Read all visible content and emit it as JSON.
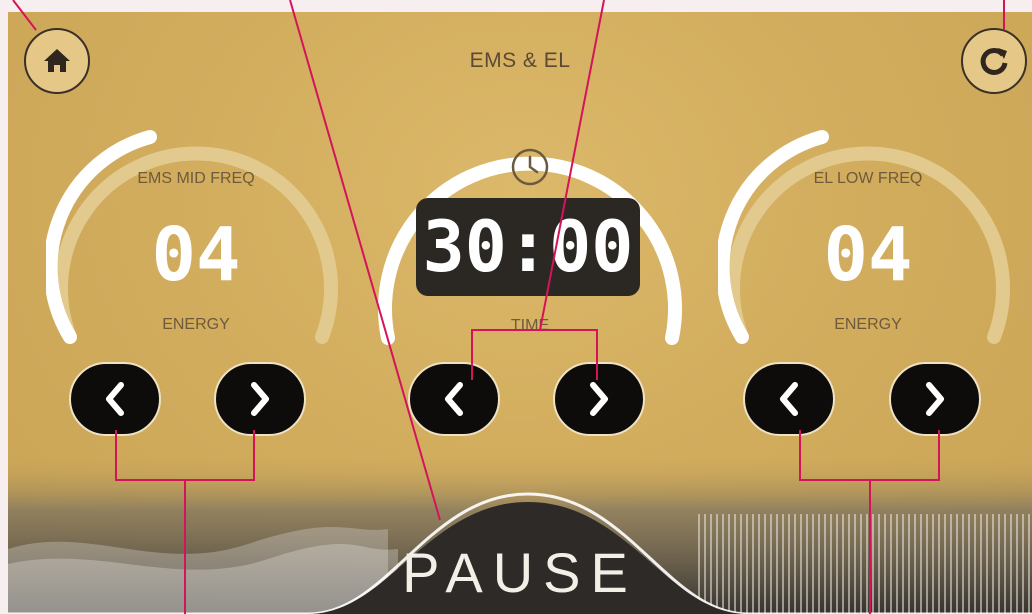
{
  "header": {
    "title": "EMS & EL"
  },
  "icons": {
    "home": "home-icon",
    "refresh": "refresh-icon",
    "clock": "clock-icon"
  },
  "dials": [
    {
      "label": "EMS MID FREQ",
      "value": "04",
      "sublabel": "ENERGY"
    },
    {
      "label": "",
      "value": "30:00",
      "sublabel": "TIME"
    },
    {
      "label": "EL LOW FREQ",
      "value": "04",
      "sublabel": "ENERGY"
    }
  ],
  "footer": {
    "pause_label": "PAUSE"
  },
  "colors": {
    "panel": "#d2ad5e",
    "button": "#0e0c0a",
    "annotation": "#d4145a"
  }
}
